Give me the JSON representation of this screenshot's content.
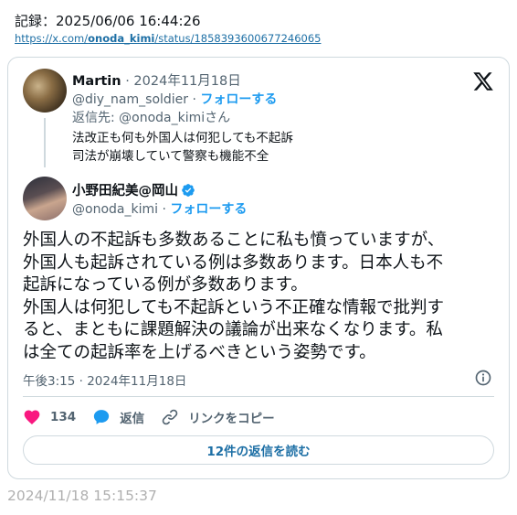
{
  "record": {
    "label": "記録：2025/06/06 16:44:26",
    "url_prefix": "https://x.com/",
    "url_user": "onoda_kimi",
    "url_suffix": "/status/1858393600677246065"
  },
  "parent_tweet": {
    "name": "Martin",
    "separator": "·",
    "date": "2024年11月18日",
    "handle": "@diy_nam_soldier",
    "follow_label": "フォローする",
    "reply_to": "返信先: @onoda_kimiさん",
    "lines": [
      "法改正も何も外国人は何犯しても不起訴",
      "司法が崩壊していて警察も機能不全"
    ]
  },
  "main_tweet": {
    "name": "小野田紀美@岡山",
    "handle": "@onoda_kimi",
    "follow_label": "フォローする",
    "lines": [
      "外国人の不起訴も多数あることに私も憤っていますが、",
      "外国人も起訴されている例は多数あります。日本人も不",
      "起訴になっている例が多数あります。",
      "外国人は何犯しても不起訴という不正確な情報で批判す",
      "ると、まともに課題解決の議論が出来なくなります。私",
      "は全ての起訴率を上げるべきという姿勢です。"
    ],
    "timestamp": "午後3:15 · 2024年11月18日",
    "likes": "134",
    "reply_label": "返信",
    "copy_link_label": "リンクをコピー",
    "read_replies_label": "12件の返信を読む"
  },
  "footer": {
    "timestamp": "2024/11/18 15:15:37"
  },
  "colors": {
    "accent": "#1d9bf0",
    "like": "#f91880",
    "secondary_text": "#536471",
    "border": "#cfd9de"
  },
  "icons": [
    "x-logo-icon",
    "verified-badge-icon",
    "info-icon",
    "heart-icon",
    "reply-bubble-icon",
    "link-icon"
  ]
}
